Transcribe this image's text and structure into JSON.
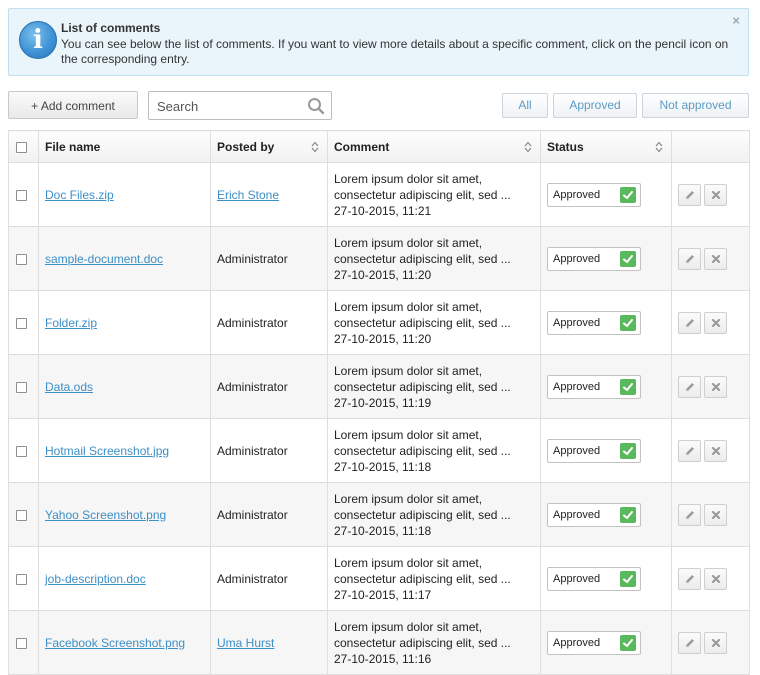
{
  "info": {
    "title": "List of comments",
    "text": "You can see below the list of comments. If you want to view more details about a specific comment, click on the pencil icon on the corresponding entry.",
    "close": "×"
  },
  "toolbar": {
    "add_label": "+ Add comment",
    "search_placeholder": "Search",
    "filters": [
      "All",
      "Approved",
      "Not approved"
    ]
  },
  "table": {
    "columns": [
      "File name",
      "Posted by",
      "Comment",
      "Status"
    ],
    "rows": [
      {
        "file": "Doc Files.zip",
        "by": "Erich Stone",
        "by_link": true,
        "comment1": "Lorem ipsum dolor sit amet,",
        "comment2": "consectetur adipiscing elit, sed ...",
        "date": "27-10-2015, 11:21",
        "status": "Approved"
      },
      {
        "file": "sample-document.doc",
        "by": "Administrator",
        "by_link": false,
        "comment1": "Lorem ipsum dolor sit amet,",
        "comment2": "consectetur adipiscing elit, sed ...",
        "date": "27-10-2015, 11:20",
        "status": "Approved"
      },
      {
        "file": "Folder.zip",
        "by": "Administrator",
        "by_link": false,
        "comment1": "Lorem ipsum dolor sit amet,",
        "comment2": "consectetur adipiscing elit, sed ...",
        "date": "27-10-2015, 11:20",
        "status": "Approved"
      },
      {
        "file": "Data.ods",
        "by": "Administrator",
        "by_link": false,
        "comment1": "Lorem ipsum dolor sit amet,",
        "comment2": "consectetur adipiscing elit, sed ...",
        "date": "27-10-2015, 11:19",
        "status": "Approved"
      },
      {
        "file": "Hotmail Screenshot.jpg",
        "by": "Administrator",
        "by_link": false,
        "comment1": "Lorem ipsum dolor sit amet,",
        "comment2": "consectetur adipiscing elit, sed ...",
        "date": "27-10-2015, 11:18",
        "status": "Approved"
      },
      {
        "file": "Yahoo Screenshot.png",
        "by": "Administrator",
        "by_link": false,
        "comment1": "Lorem ipsum dolor sit amet,",
        "comment2": "consectetur adipiscing elit, sed ...",
        "date": "27-10-2015, 11:18",
        "status": "Approved"
      },
      {
        "file": "job-description.doc",
        "by": "Administrator",
        "by_link": false,
        "comment1": "Lorem ipsum dolor sit amet,",
        "comment2": "consectetur adipiscing elit, sed ...",
        "date": "27-10-2015, 11:17",
        "status": "Approved"
      },
      {
        "file": "Facebook Screenshot.png",
        "by": "Uma Hurst",
        "by_link": true,
        "comment1": "Lorem ipsum dolor sit amet,",
        "comment2": "consectetur adipiscing elit, sed ...",
        "date": "27-10-2015, 11:16",
        "status": "Approved"
      }
    ]
  },
  "icons": {
    "info": "info-icon",
    "search": "search-icon",
    "sort": "sort-icon",
    "check": "check-icon",
    "edit": "pencil-icon",
    "delete": "close-icon"
  },
  "colors": {
    "link": "#3c8fc7",
    "approved": "#5cb85c",
    "info_bg": "#eaf5fb"
  }
}
